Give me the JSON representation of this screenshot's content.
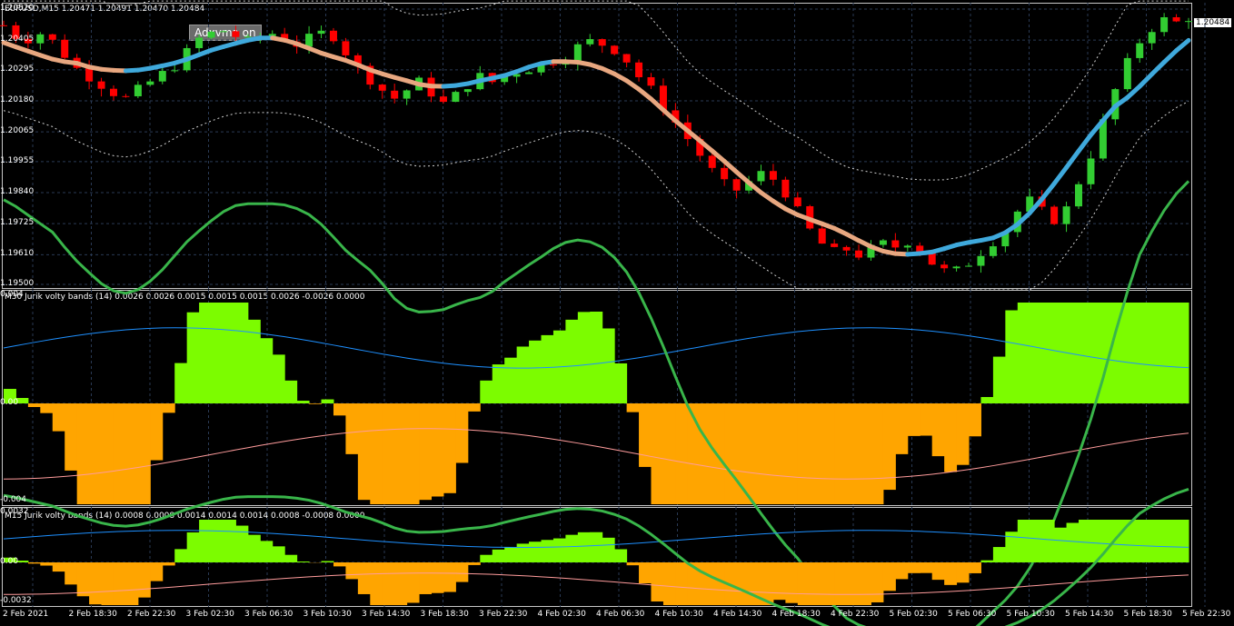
{
  "header": {
    "symbol_line": "EURUSD,M15  1.20471 1.20491 1.20470 1.20484",
    "overlay_tag": "Adxvma on",
    "current_price": "1.20484"
  },
  "indicators": [
    {
      "label": "M30 Jurik volty bands (14) 0.0026 0.0026 0.0015 0.0015 0.0015 0.0026 -0.0026 0.0000"
    },
    {
      "label": "M15 Jurik volty bands (14) 0.0008 0.0008 0.0014 0.0014 0.0014 0.0008 -0.0008 0.0000"
    }
  ],
  "price_axis": [
    "1.20520",
    "1.20405",
    "1.20295",
    "1.20180",
    "1.20065",
    "1.19955",
    "1.19840",
    "1.19725",
    "1.19610",
    "1.19500"
  ],
  "ind1_axis": [
    "0.004",
    "0.00",
    "-0.004"
  ],
  "ind2_axis": [
    "0.0032",
    "0.00",
    "-0.0032"
  ],
  "time_axis": [
    "2 Feb 2021",
    "2 Feb 18:30",
    "2 Feb 22:30",
    "3 Feb 02:30",
    "3 Feb 06:30",
    "3 Feb 10:30",
    "3 Feb 14:30",
    "3 Feb 18:30",
    "3 Feb 22:30",
    "4 Feb 02:30",
    "4 Feb 06:30",
    "4 Feb 10:30",
    "4 Feb 14:30",
    "4 Feb 18:30",
    "4 Feb 22:30",
    "5 Feb 02:30",
    "5 Feb 06:30",
    "5 Feb 10:30",
    "5 Feb 14:30",
    "5 Feb 18:30",
    "5 Feb 22:30"
  ],
  "colors": {
    "background": "#000000",
    "bull": "#32cd32",
    "bear": "#ff0000",
    "adx_up": "#3fa9dc",
    "adx_down": "#e8a780",
    "band_pos": "#7cfc00",
    "band_neg": "#ffa500",
    "line_blue": "#1e90ff",
    "line_pink": "#ff9c9c",
    "ma_green": "#39b54a",
    "ma_red": "#ff1a1a"
  },
  "chart_data": {
    "type": "candlestick",
    "title": "EURUSD,M15",
    "ylim": [
      1.195,
      1.2052
    ],
    "closes": [
      1.2046,
      1.2042,
      1.2041,
      1.2043,
      1.204,
      1.2035,
      1.203,
      1.2027,
      1.2024,
      1.2021,
      1.2019,
      1.2022,
      1.2025,
      1.2028,
      1.2031,
      1.2036,
      1.2041,
      1.2043,
      1.2044,
      1.2042,
      1.204,
      1.2042,
      1.2043,
      1.2041,
      1.2039,
      1.2041,
      1.2043,
      1.2042,
      1.2036,
      1.203,
      1.2026,
      1.2022,
      1.2019,
      1.2022,
      1.2025,
      1.2021,
      1.2017,
      1.202,
      1.2024,
      1.2027,
      1.2025,
      1.2027,
      1.2029,
      1.203,
      1.2031,
      1.2033,
      1.2034,
      1.2038,
      1.204,
      1.2039,
      1.2037,
      1.2033,
      1.2027,
      1.2022,
      1.2016,
      1.201,
      1.2004,
      1.1998,
      1.1992,
      1.1987,
      1.1985,
      1.1988,
      1.1991,
      1.1989,
      1.1984,
      1.1977,
      1.197,
      1.1965,
      1.1962,
      1.1963,
      1.1961,
      1.1963,
      1.1965,
      1.1964,
      1.1966,
      1.1963,
      1.1958,
      1.1955,
      1.1955,
      1.1958,
      1.1962,
      1.1966,
      1.197,
      1.1977,
      1.1981,
      1.1977,
      1.1974,
      1.1978,
      1.1988,
      1.1998,
      1.201,
      1.2022,
      1.2032,
      1.204,
      1.2045,
      1.2048,
      1.2047,
      1.2049
    ]
  }
}
